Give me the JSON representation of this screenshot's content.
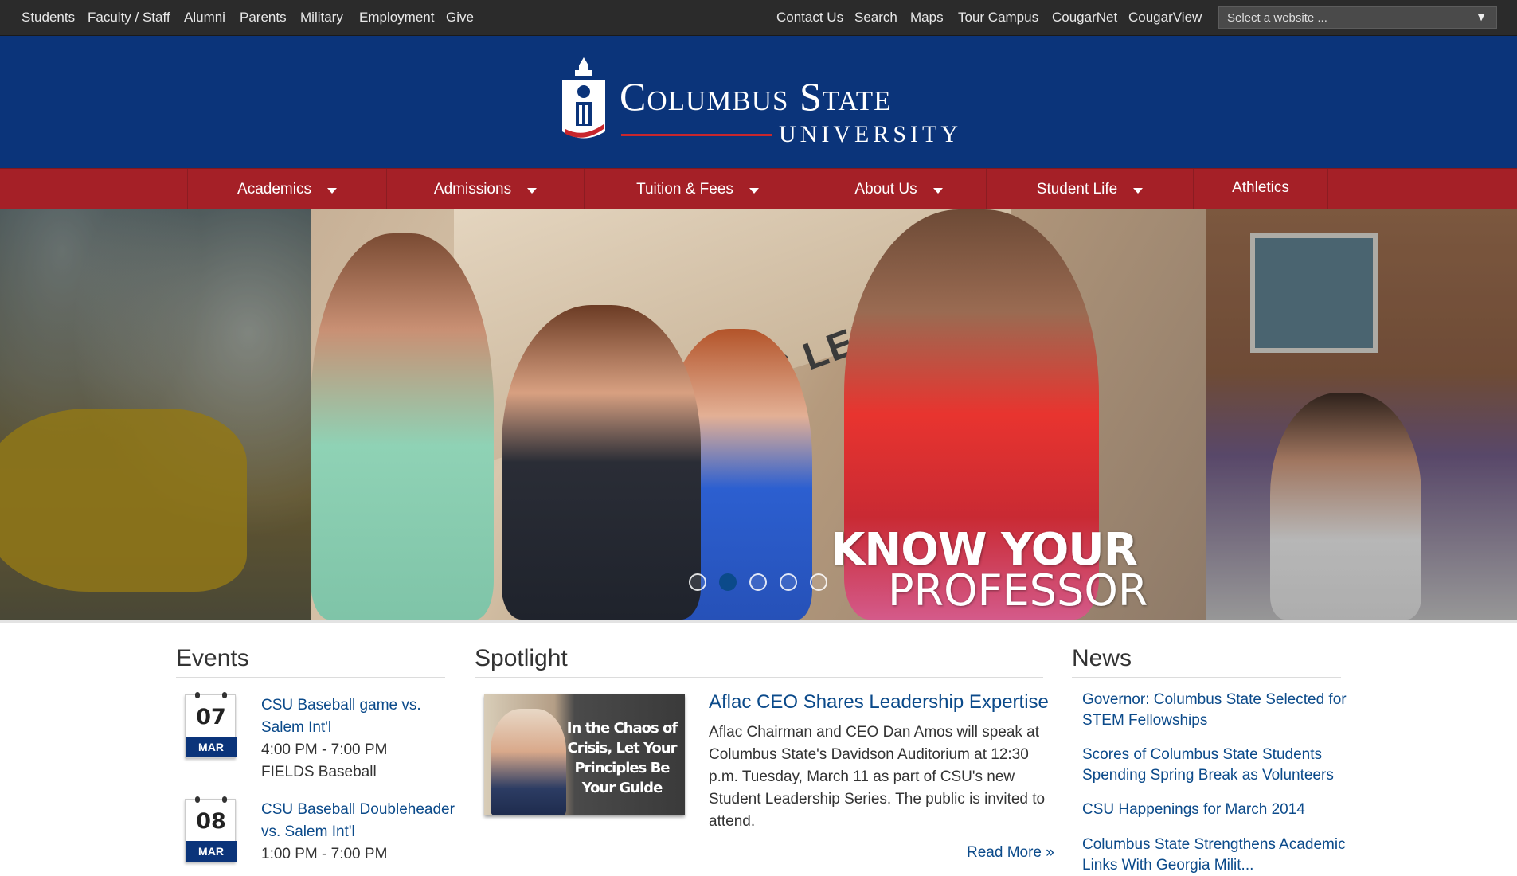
{
  "topbar": {
    "left_links": [
      "Students",
      "Faculty / Staff",
      "Alumni",
      "Parents",
      "Military",
      "Employment",
      "Give"
    ],
    "right_links": [
      "Contact Us",
      "Search",
      "Maps",
      "Tour Campus",
      "CougarNet",
      "CougarView"
    ],
    "site_select": "Select a website ..."
  },
  "header": {
    "logo_line1": "Columbus State",
    "logo_line2": "UNIVERSITY"
  },
  "nav": {
    "items": [
      {
        "label": "Academics",
        "has_dropdown": true
      },
      {
        "label": "Admissions",
        "has_dropdown": true
      },
      {
        "label": "Tuition & Fees",
        "has_dropdown": true
      },
      {
        "label": "About Us",
        "has_dropdown": true
      },
      {
        "label": "Student Life",
        "has_dropdown": true
      },
      {
        "label": "Athletics",
        "has_dropdown": false
      }
    ]
  },
  "hero": {
    "building_sign": "C LENOIR HALL",
    "title_line1": "KNOW YOUR",
    "title_line2": "PROFESSOR",
    "slides_count": 5,
    "active_slide": 2
  },
  "events": {
    "heading": "Events",
    "items": [
      {
        "day": "07",
        "month": "MAR",
        "title": "CSU Baseball game vs. Salem Int'l",
        "time": "4:00 PM - 7:00 PM",
        "location": "FIELDS Baseball"
      },
      {
        "day": "08",
        "month": "MAR",
        "title": "CSU Baseball Doubleheader vs. Salem Int'l",
        "time": "1:00 PM - 7:00 PM",
        "location": ""
      }
    ]
  },
  "spotlight": {
    "heading": "Spotlight",
    "image_caption": "In the Chaos of Crisis, Let Your Principles Be Your Guide",
    "title": "Aflac CEO Shares Leadership Expertise",
    "body": "Aflac Chairman and CEO Dan Amos will speak at Columbus State's Davidson Auditorium at 12:30 p.m. Tuesday, March 11 as part of CSU's new Student Leadership Series. The public is invited to attend.",
    "read_more": "Read More »"
  },
  "news": {
    "heading": "News",
    "items": [
      "Governor: Columbus State Selected for STEM Fellowships",
      "Scores of Columbus State Students Spending Spring Break as Volunteers",
      "CSU Happenings for March 2014",
      "Columbus State Strengthens Academic Links With Georgia Milit..."
    ]
  },
  "colors": {
    "topbar_bg": "#2b2b2b",
    "header_blue": "#0b347a",
    "nav_red": "#a52027",
    "link_blue": "#0b4a8a"
  }
}
